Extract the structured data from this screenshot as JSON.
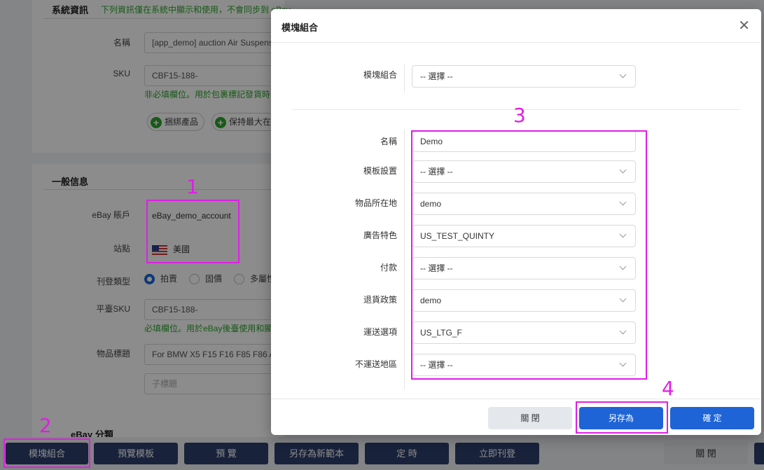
{
  "background": {
    "system_section": {
      "title": "系統資訊",
      "note": "下列資訊僅在系統中顯示和使用，不會同步到 eBay",
      "name_label": "名稱",
      "name_value": "[app_demo] auction Air Suspens",
      "sku_label": "SKU",
      "sku_value": "CBF15-188-",
      "sku_hint": "非必填欄位。用於包裹標記發貨時",
      "bind_product_btn": "捆綁產品",
      "keep_max_btn": "保持最大在"
    },
    "general_section": {
      "title": "一般信息",
      "account_label": "eBay 賬戶",
      "account_value": "eBay_demo_account",
      "site_label": "站點",
      "site_value": "美國",
      "listing_type_label": "刊登類型",
      "listing_types": [
        "拍賣",
        "固價",
        "多屬性"
      ],
      "platform_sku_label": "平臺SKU",
      "platform_sku_value": "CBF15-188-",
      "platform_sku_hint": "必填欄位。用於eBay後臺使用和顯",
      "item_title_label": "物品標題",
      "item_title_value": "For BMW X5 F15 F16 F85 F86 A",
      "subtitle_placeholder": "子標題",
      "category_label": "eBay 分類"
    },
    "bottom_buttons": [
      "模塊組合",
      "預覽模板",
      "預 覽",
      "另存為新範本",
      "定 時",
      "立即刊登"
    ],
    "bottom_close": "關 閉"
  },
  "modal": {
    "title": "模塊組合",
    "close_icon": "close-icon",
    "combo_label": "模塊組合",
    "combo_value": "-- 選擇 --",
    "fields": [
      {
        "label": "名稱",
        "value": "Demo",
        "kind": "text"
      },
      {
        "label": "模板設置",
        "value": "-- 選擇 --",
        "kind": "select"
      },
      {
        "label": "物品所在地",
        "value": "demo",
        "kind": "select"
      },
      {
        "label": "廣告特色",
        "value": "US_TEST_QUINTY",
        "kind": "select"
      },
      {
        "label": "付款",
        "value": "-- 選擇 --",
        "kind": "select"
      },
      {
        "label": "退貨政策",
        "value": "demo",
        "kind": "select"
      },
      {
        "label": "運送選項",
        "value": "US_LTG_F",
        "kind": "select"
      },
      {
        "label": "不運送地區",
        "value": "-- 選擇 --",
        "kind": "select"
      }
    ],
    "footer": {
      "close_label": "關 閉",
      "save_as_label": "另存為",
      "confirm_label": "確 定"
    }
  },
  "annotations": [
    "1",
    "2",
    "3",
    "4"
  ],
  "colors": {
    "annotation": "#e01ee6",
    "primary_button": "#1e64d6",
    "bottom_button": "#2c3e6c",
    "hint_green": "#2aa52a"
  }
}
